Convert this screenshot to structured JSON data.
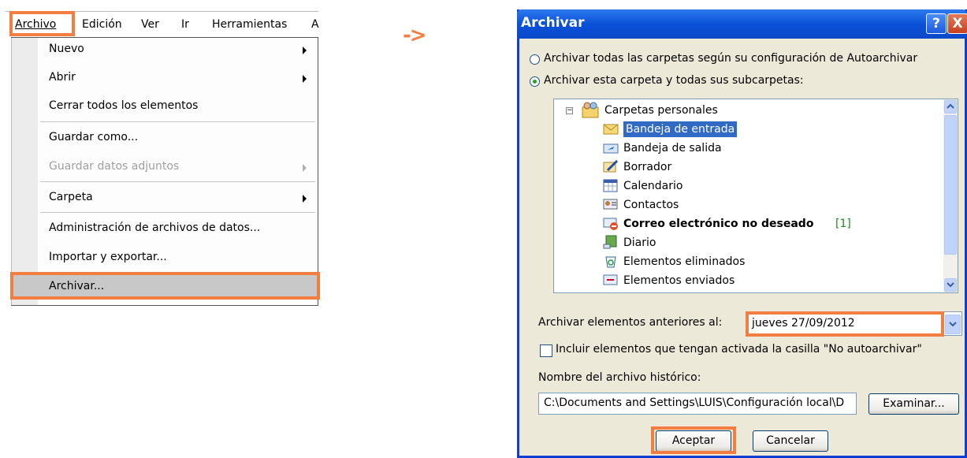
{
  "menu": {
    "menubar": [
      {
        "label": "Archivo",
        "mnemonic_index": 0
      },
      {
        "label": "Edición",
        "mnemonic_index": 0
      },
      {
        "label": "Ver",
        "mnemonic_index": 0
      },
      {
        "label": "Ir",
        "mnemonic_index": 0
      },
      {
        "label": "Herramientas",
        "mnemonic_index": 0
      },
      {
        "label": "A",
        "mnemonic_index": -1
      }
    ],
    "items": [
      {
        "label": "Nuevo",
        "submenu": true,
        "enabled": true
      },
      {
        "label": "Abrir",
        "submenu": true,
        "enabled": true
      },
      {
        "label": "Cerrar todos los elementos",
        "submenu": false,
        "enabled": true
      },
      {
        "label": "Guardar como...",
        "submenu": false,
        "enabled": true
      },
      {
        "label": "Guardar datos adjuntos",
        "submenu": true,
        "enabled": false
      },
      {
        "label": "Carpeta",
        "submenu": true,
        "enabled": true
      },
      {
        "label": "Administración de archivos de datos...",
        "submenu": false,
        "enabled": true
      },
      {
        "label": "Importar y exportar...",
        "submenu": false,
        "enabled": true
      },
      {
        "label": "Archivar...",
        "submenu": false,
        "enabled": true
      }
    ]
  },
  "arrow": "->",
  "dialog": {
    "title": "Archivar",
    "help": "?",
    "close": "X",
    "option_auto": "Archivar todas las carpetas según su configuración de Autoarchivar",
    "option_folder": "Archivar esta carpeta y todas sus subcarpetas:",
    "tree_root": "Carpetas personales",
    "tree_items": [
      {
        "label": "Bandeja de entrada",
        "icon": "inbox-icon",
        "selected": true
      },
      {
        "label": "Bandeja de salida",
        "icon": "outbox-icon"
      },
      {
        "label": "Borrador",
        "icon": "drafts-icon"
      },
      {
        "label": "Calendario",
        "icon": "calendar-icon"
      },
      {
        "label": "Contactos",
        "icon": "contacts-icon"
      },
      {
        "label": "Correo electrónico no deseado",
        "icon": "junk-mail-icon",
        "bold": true,
        "count": "[1]"
      },
      {
        "label": "Diario",
        "icon": "journal-icon"
      },
      {
        "label": "Elementos eliminados",
        "icon": "deleted-items-icon"
      },
      {
        "label": "Elementos enviados",
        "icon": "sent-items-icon"
      }
    ],
    "date_label": "Archivar elementos anteriores al:",
    "date_value": "jueves 27/09/2012",
    "no_autoarchive_label": "Incluir elementos que tengan activada la casilla \"No autoarchivar\"",
    "file_label": "Nombre del archivo histórico:",
    "file_value": "C:\\Documents and Settings\\LUIS\\Configuración local\\D",
    "browse": "Examinar...",
    "ok": "Aceptar",
    "cancel": "Cancelar"
  },
  "colors": {
    "highlight": "#f47e42",
    "selection": "#316ac5",
    "titlebar": "#0a51d8"
  }
}
